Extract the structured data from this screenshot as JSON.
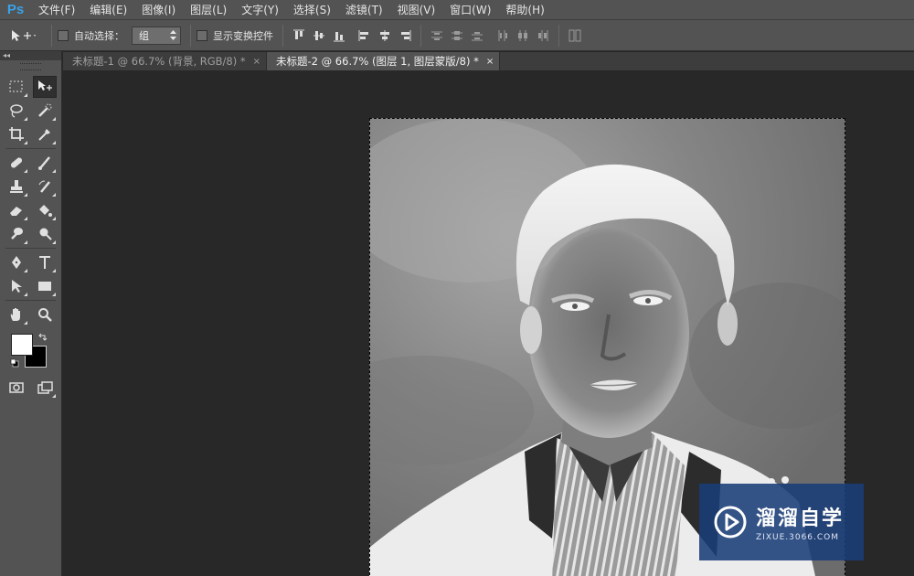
{
  "app": {
    "logo": "Ps"
  },
  "menu": [
    "文件(F)",
    "编辑(E)",
    "图像(I)",
    "图层(L)",
    "文字(Y)",
    "选择(S)",
    "滤镜(T)",
    "视图(V)",
    "窗口(W)",
    "帮助(H)"
  ],
  "options": {
    "auto_select_label": "自动选择：",
    "auto_select_value": "组",
    "show_transform_label": "显示变换控件"
  },
  "toolbox": {
    "collapse_label": "◂◂"
  },
  "tabs": [
    {
      "label": "未标题-1 @ 66.7% (背景, RGB/8) *",
      "close": "×",
      "active": false
    },
    {
      "label": "未标题-2 @ 66.7% (图层 1, 图层蒙版/8) *",
      "close": "×",
      "active": true
    }
  ],
  "watermark": {
    "title": "溜溜自学",
    "subtitle": "ZIXUE.3066.COM"
  },
  "colors": {
    "foreground": "#ffffff",
    "background": "#000000",
    "ps_blue": "#3aa2e8"
  }
}
